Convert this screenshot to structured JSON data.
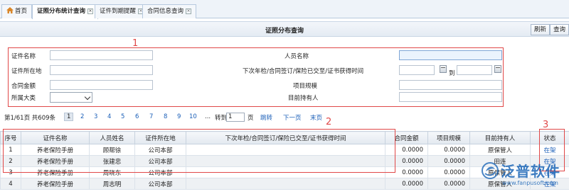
{
  "tabs": [
    {
      "label": "首页"
    },
    {
      "label": "证照分布统计查询"
    },
    {
      "label": "证件到期提醒"
    },
    {
      "label": "合同信息查询"
    }
  ],
  "page": {
    "title": "证照分布查询",
    "refresh_label": "刷新",
    "query_label": "查询"
  },
  "form": {
    "cert_name_label": "证件名称",
    "cert_location_label": "证件所在地",
    "contract_amount_label": "合同金额",
    "category_label": "所属大类",
    "category_value": "",
    "person_name_label": "人员名称",
    "next_date_label": "下次年检/合同签订/保险已交至/证书获得时间",
    "date_to_label": "到",
    "project_scale_label": "项目规模",
    "current_holder_label": "目前持有人"
  },
  "pager": {
    "summary": "第1/61页 共609条",
    "pages": [
      "1",
      "2",
      "3",
      "4",
      "5",
      "6",
      "7",
      "8",
      "9",
      "10"
    ],
    "ellipsis": "...",
    "goto_label": "转到",
    "goto_value": "1",
    "page_unit": "页",
    "jump_label": "跳转",
    "next_label": "下一页",
    "last_label": "末页"
  },
  "markers": [
    "1",
    "2",
    "3"
  ],
  "table": {
    "headers": [
      "序号",
      "证件名称",
      "人员姓名",
      "证件所在地",
      "下次年检/合同签订/保险已交至/证书获得时间",
      "合同金额",
      "项目规模",
      "目前持有人",
      "状态"
    ],
    "rows": [
      {
        "no": "1",
        "cert": "养老保险手册",
        "person": "顾帮徐",
        "location": "公司本部",
        "next_date": "",
        "amount": "0.0000",
        "scale": "0.0000",
        "holder": "原保管人",
        "status": "在架"
      },
      {
        "no": "2",
        "cert": "养老保险手册",
        "person": "张建忠",
        "location": "公司本部",
        "next_date": "",
        "amount": "0.0000",
        "scale": "0.0000",
        "holder": "田连",
        "status": "在架"
      },
      {
        "no": "3",
        "cert": "养老保险手册",
        "person": "周晓东",
        "location": "公司本部",
        "next_date": "",
        "amount": "0.0000",
        "scale": "0.0000",
        "holder": "原保管人",
        "status": "在架"
      },
      {
        "no": "4",
        "cert": "养老保险手册",
        "person": "周志明",
        "location": "公司本部",
        "next_date": "",
        "amount": "0.0000",
        "scale": "0.0000",
        "holder": "原保管人",
        "status": "在架"
      }
    ]
  },
  "watermark": {
    "brand": "泛普软件",
    "url": "www.fanpusoft.com"
  },
  "colors": {
    "accent_red": "#e04848",
    "link_blue": "#1b5fb8"
  }
}
